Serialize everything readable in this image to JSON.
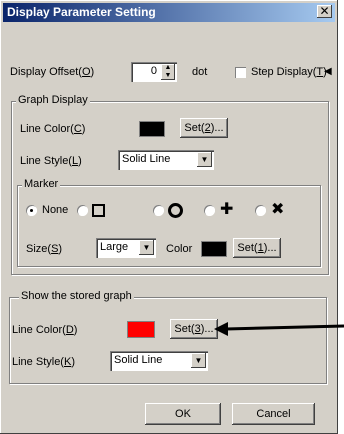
{
  "window": {
    "title": "Display Parameter Setting",
    "close_glyph": "✕"
  },
  "display_offset": {
    "label": "Display Offset(",
    "key": "O",
    "label_end": ")",
    "value": "0",
    "unit": "dot"
  },
  "step_display": {
    "label": "Step Display(",
    "key": "T",
    "label_end": ")",
    "checked": false
  },
  "graph_display": {
    "title": "Graph Display",
    "line_color": {
      "label": "Line Color(",
      "key": "C",
      "label_end": ")",
      "color": "#000000"
    },
    "set_button": {
      "label": "Set(",
      "key": "2",
      "label_end": ")..."
    },
    "line_style": {
      "label": "Line Style(",
      "key": "L",
      "label_end": ")",
      "value": "Solid Line"
    }
  },
  "marker": {
    "title": "Marker",
    "options": [
      {
        "label": "None",
        "selected": true,
        "symbol": ""
      },
      {
        "label": "",
        "selected": false,
        "symbol": "square-marker"
      },
      {
        "label": "",
        "selected": false,
        "symbol": "circle-marker"
      },
      {
        "label": "",
        "selected": false,
        "symbol": "plus-marker"
      },
      {
        "label": "",
        "selected": false,
        "symbol": "x-marker"
      }
    ],
    "size": {
      "label": "Size(",
      "key": "S",
      "label_end": ")",
      "value": "Large"
    },
    "color": {
      "label": "Color",
      "color": "#000000"
    },
    "set_button": {
      "label": "Set(",
      "key": "1",
      "label_end": ")..."
    }
  },
  "stored_graph": {
    "title": "Show the stored graph",
    "line_color": {
      "label": "Line Color(",
      "key": "D",
      "label_end": ")",
      "color": "#ff0000"
    },
    "set_button": {
      "label": "Set(",
      "key": "3",
      "label_end": ")..."
    },
    "line_style": {
      "label": "Line Style(",
      "key": "K",
      "label_end": ")",
      "value": "Solid Line"
    }
  },
  "buttons": {
    "ok": "OK",
    "cancel": "Cancel"
  }
}
